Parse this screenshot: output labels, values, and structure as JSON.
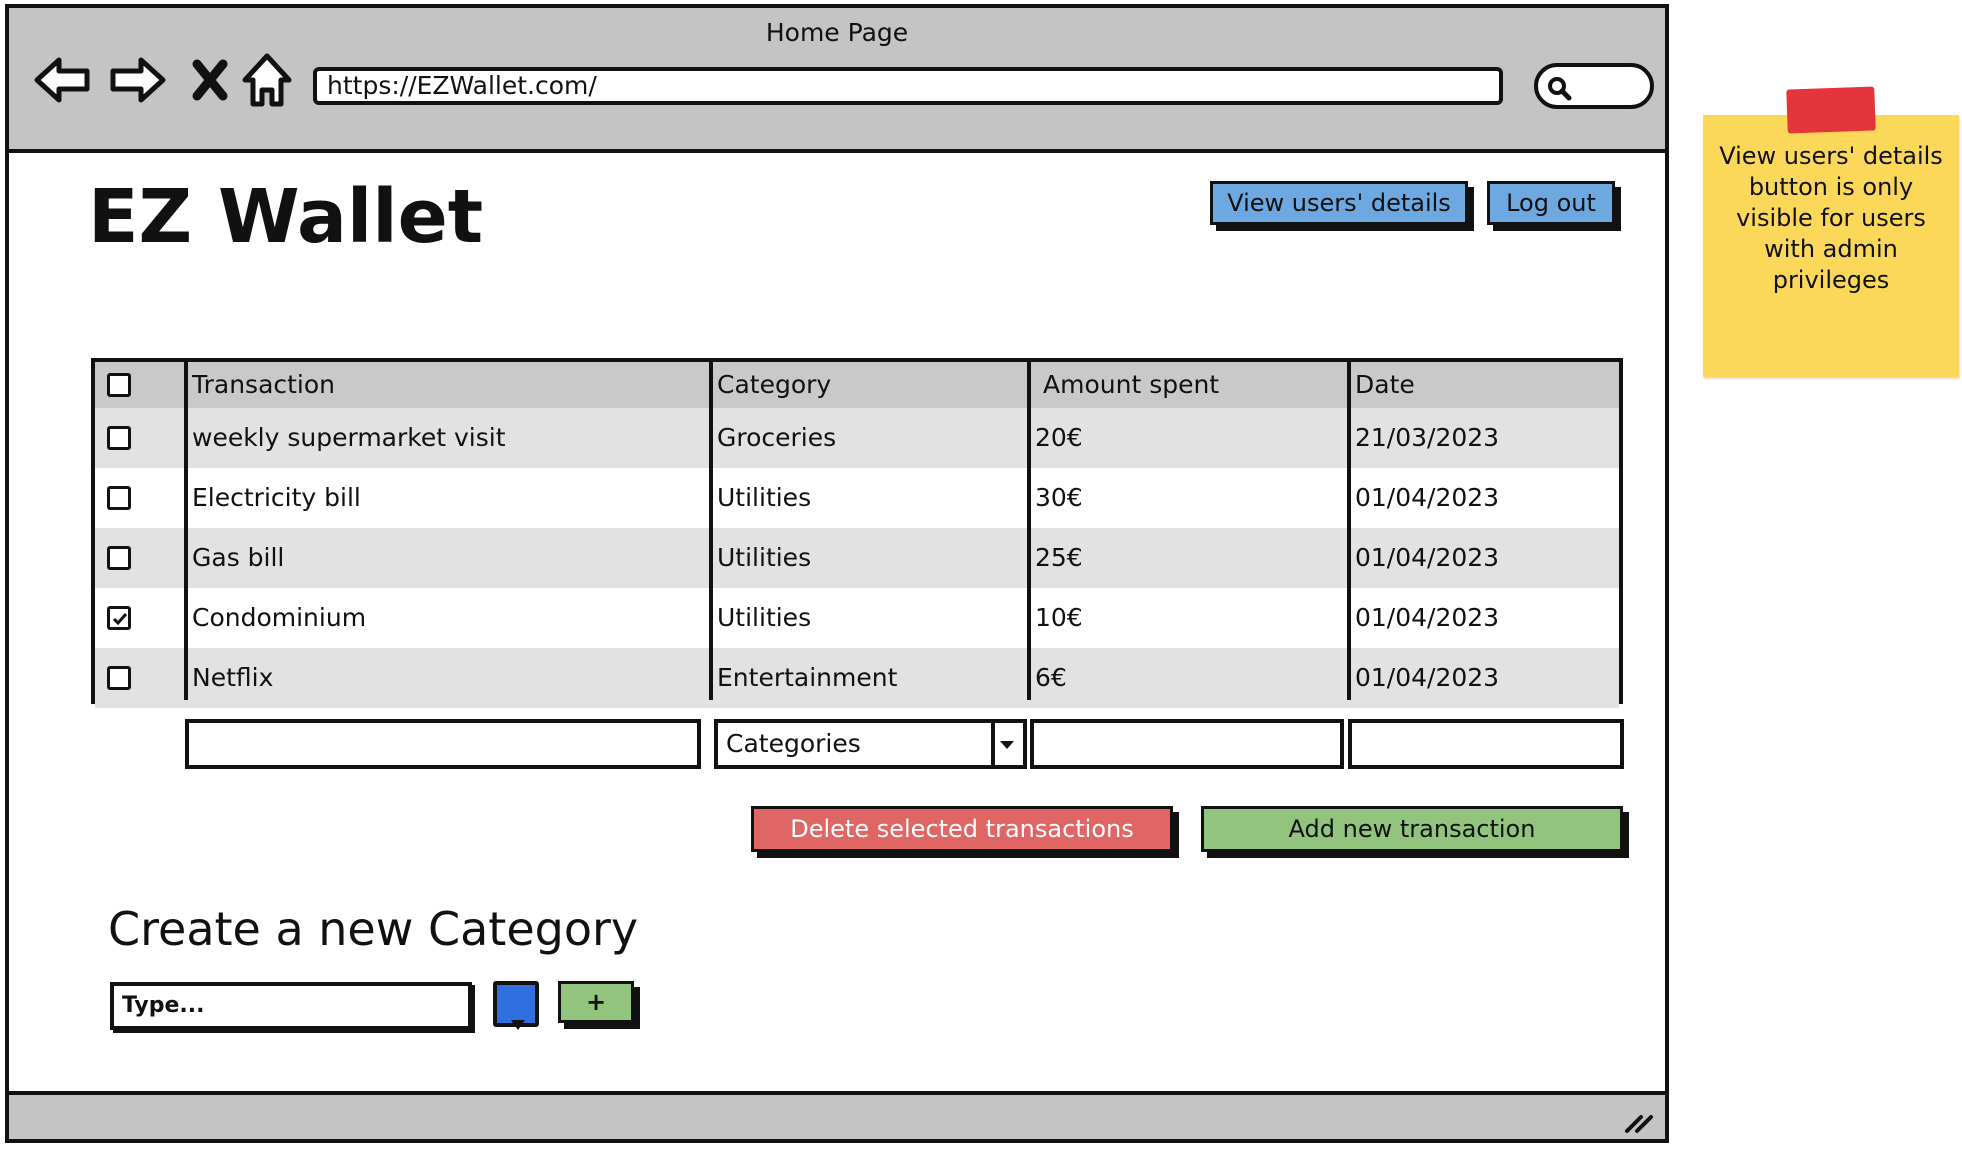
{
  "window": {
    "title": "Home Page"
  },
  "browser": {
    "url": "https://EZWallet.com/",
    "icons": [
      "back-arrow-icon",
      "forward-arrow-icon",
      "stop-icon",
      "home-icon",
      "search-icon"
    ]
  },
  "header": {
    "app_title": "EZ Wallet",
    "view_users_label": "View users' details",
    "logout_label": "Log out"
  },
  "table": {
    "columns": [
      "Transaction",
      "Category",
      "Amount spent",
      "Date"
    ],
    "rows": [
      {
        "transaction": "weekly supermarket visit",
        "category": "Groceries",
        "amount": "20€",
        "date": "21/03/2023",
        "checked": false
      },
      {
        "transaction": "Electricity bill",
        "category": "Utilities",
        "amount": "30€",
        "date": "01/04/2023",
        "checked": false
      },
      {
        "transaction": "Gas bill",
        "category": "Utilities",
        "amount": "25€",
        "date": "01/04/2023",
        "checked": false
      },
      {
        "transaction": "Condominium",
        "category": "Utilities",
        "amount": "10€",
        "date": "01/04/2023",
        "checked": true
      },
      {
        "transaction": "Netflix",
        "category": "Entertainment",
        "amount": "6€",
        "date": "01/04/2023",
        "checked": false
      }
    ]
  },
  "new_transaction": {
    "transaction_value": "",
    "category_select": "Categories",
    "amount_value": "",
    "date_value": ""
  },
  "actions": {
    "delete_label": "Delete selected transactions",
    "add_label": "Add new transaction"
  },
  "category_form": {
    "title": "Create a new Category",
    "placeholder": "Type...",
    "add_label": "+",
    "swatch_color": "#2f6fe0"
  },
  "note": {
    "text": "View users' details button is only visible for users with admin privileges"
  },
  "colors": {
    "chrome_bg": "#c4c4c4",
    "blue_button": "#6ea8e0",
    "red_button": "#e06666",
    "green_button": "#93c47d",
    "sticky_note": "#fcd85a",
    "row_shaded": "#e2e2e2",
    "header_row": "#c9c9c9"
  }
}
